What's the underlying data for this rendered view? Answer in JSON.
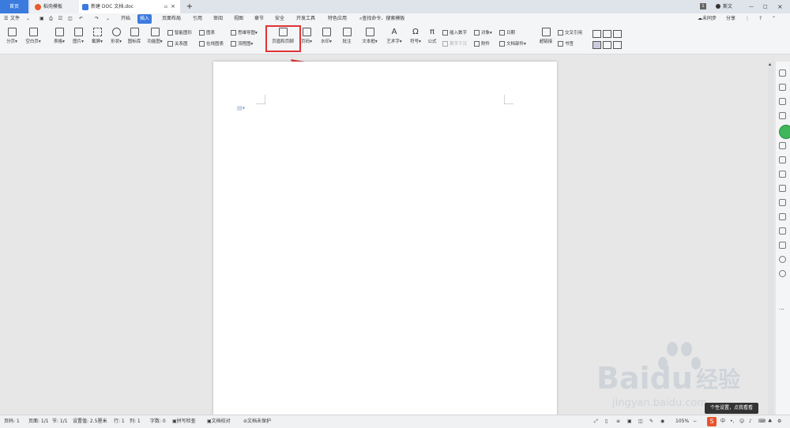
{
  "tabs": {
    "home": "首页",
    "straw": "稻壳模板",
    "doc": "新建 DOC 文档.doc"
  },
  "title_right": {
    "user": "斯文",
    "badge": "1"
  },
  "menu": {
    "file": "文件",
    "items": [
      "开始",
      "插入",
      "页面布局",
      "引用",
      "审阅",
      "视图",
      "章节",
      "安全",
      "开发工具",
      "特色应用"
    ],
    "search": "查找命令、搜索模板",
    "sync": "未同步",
    "share": "分享"
  },
  "ribbon": {
    "page_break": "分页",
    "blank_page": "空白页",
    "table": "表格",
    "picture": "图片",
    "screenshot": "截屏",
    "shape": "形状",
    "icon_lib": "图标库",
    "func_chart": "功能图",
    "smart_shape": "智能图形",
    "relation": "关系图",
    "chart": "图表",
    "online_chart": "在线图表",
    "mindmap": "思维导图",
    "flowchart": "流程图",
    "header_footer": "页眉和页脚",
    "page_number": "页码",
    "watermark": "水印",
    "comment": "批注",
    "textbox": "文本框",
    "wordart": "艺术字",
    "symbol": "符号",
    "formula": "公式",
    "insert_number": "插入数字",
    "object": "对象",
    "date": "日期",
    "drop_cap": "首字下沉",
    "attachment": "附件",
    "doc_parts": "文档部件",
    "hyperlink": "超链接",
    "cross_ref": "交叉引用",
    "bookmark": "书签"
  },
  "status": {
    "page": "页码: 1",
    "pages": "页面: 1/1",
    "section": "节: 1/1",
    "setting": "设置值: 2.5厘米",
    "row": "行: 1",
    "col": "列: 1",
    "words": "字数: 0",
    "spell": "拼写检查",
    "proof": "文档校对",
    "protect": "文档未保护",
    "zoom": "105%"
  },
  "tooltip": "个性设置，点我看看",
  "watermark": {
    "brand": "Baidu",
    "cn": "经验",
    "url": "jingyan.baidu.com"
  },
  "colors": {
    "accent": "#3b7bde",
    "highlight": "#e03434"
  }
}
